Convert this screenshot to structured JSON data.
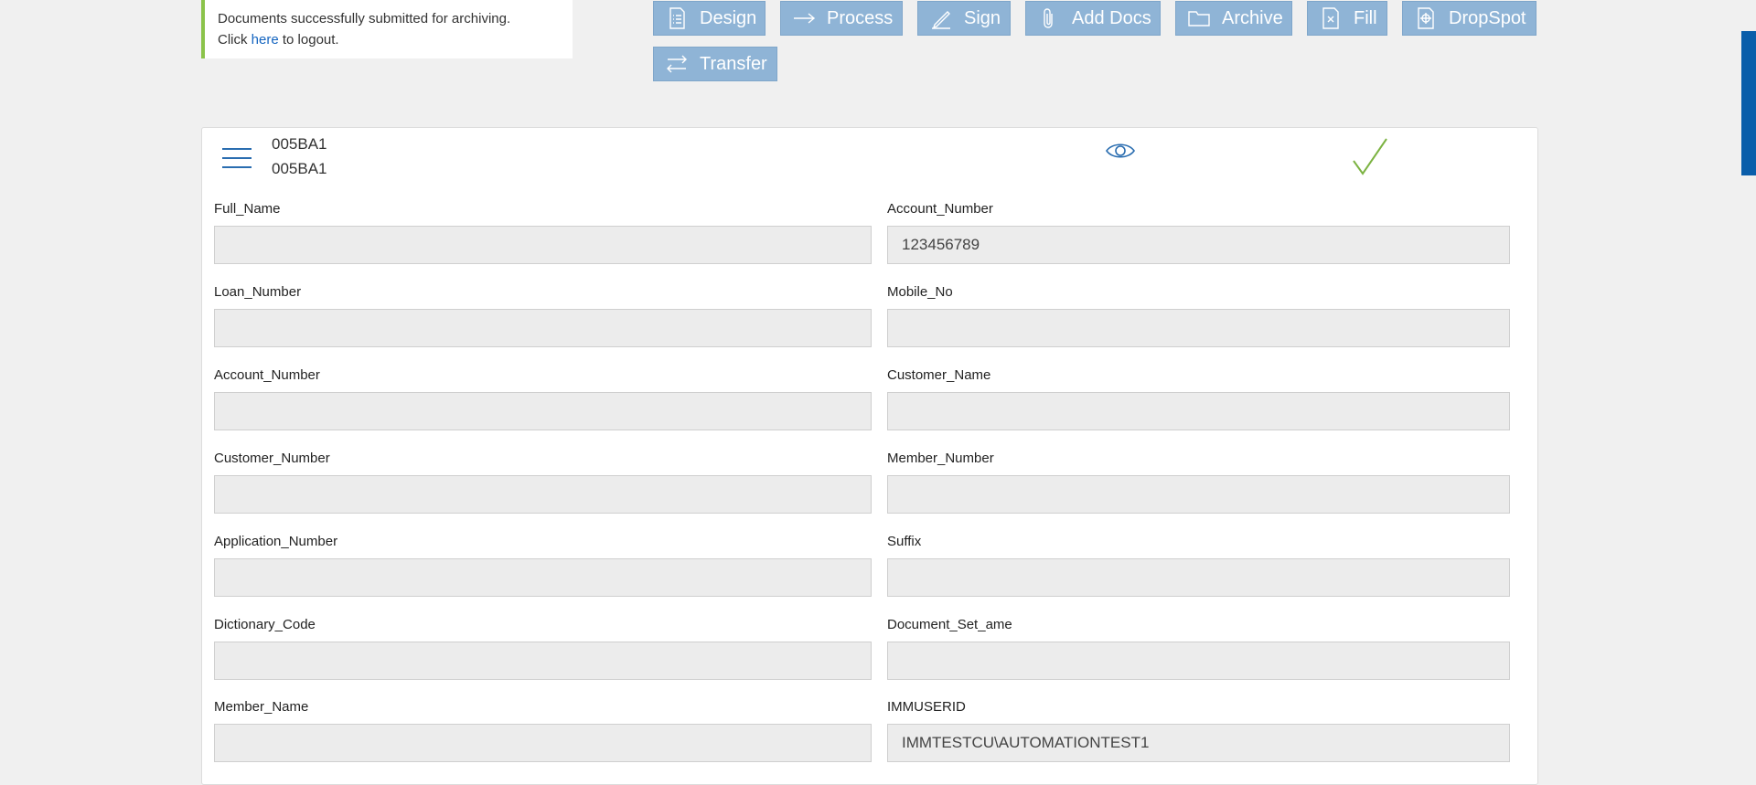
{
  "notice": {
    "message": "Documents successfully submitted for archiving.",
    "click_text": "Click",
    "link_text": "here",
    "suffix_text": "to logout."
  },
  "toolbar": {
    "buttons": [
      {
        "label": "Design",
        "icon": "document-list-icon"
      },
      {
        "label": "Process",
        "icon": "arrow-right-icon"
      },
      {
        "label": "Sign",
        "icon": "pen-icon"
      },
      {
        "label": "Add Docs",
        "icon": "paperclip-icon"
      },
      {
        "label": "Archive",
        "icon": "folder-icon"
      },
      {
        "label": "Fill",
        "icon": "document-x-icon"
      },
      {
        "label": "DropSpot",
        "icon": "document-target-icon"
      },
      {
        "label": "Transfer",
        "icon": "swap-arrows-icon"
      }
    ]
  },
  "document": {
    "id_line1": "005BA1",
    "id_line2": "005BA1"
  },
  "fields": [
    {
      "label": "Full_Name",
      "value": ""
    },
    {
      "label": "Account_Number",
      "value": "123456789"
    },
    {
      "label": "Loan_Number",
      "value": ""
    },
    {
      "label": "Mobile_No",
      "value": ""
    },
    {
      "label": "Account_Number",
      "value": ""
    },
    {
      "label": "Customer_Name",
      "value": ""
    },
    {
      "label": "Customer_Number",
      "value": ""
    },
    {
      "label": "Member_Number",
      "value": ""
    },
    {
      "label": "Application_Number",
      "value": ""
    },
    {
      "label": "Suffix",
      "value": ""
    },
    {
      "label": "Dictionary_Code",
      "value": ""
    },
    {
      "label": "Document_Set_ame",
      "value": ""
    },
    {
      "label": "Member_Name",
      "value": ""
    },
    {
      "label": "IMMUSERID",
      "value": "IMMTESTCU\\AUTOMATIONTEST1"
    }
  ],
  "colors": {
    "toolbar_button": "#8fb4d6",
    "notice_accent": "#8bc34a",
    "link": "#1565c0",
    "check": "#7cb342",
    "edge_bar": "#0a5eaa"
  }
}
